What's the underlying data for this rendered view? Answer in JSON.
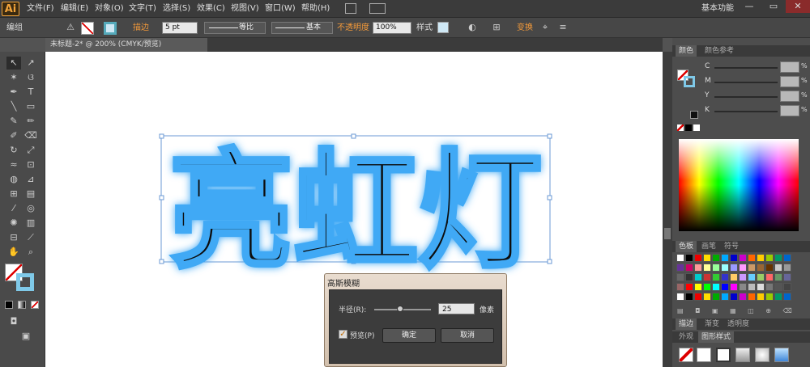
{
  "app": {
    "logo": "Ai",
    "workspace": "基本功能"
  },
  "menubar": {
    "items": [
      "文件(F)",
      "编辑(E)",
      "对象(O)",
      "文字(T)",
      "选择(S)",
      "效果(C)",
      "视图(V)",
      "窗口(W)",
      "帮助(H)"
    ]
  },
  "window_buttons": {
    "minimize": "—",
    "restore": "▭",
    "close": "✕"
  },
  "control_bar": {
    "selection_label": "编组",
    "stroke_label": "描边",
    "stroke_weight": "5 pt",
    "stroke_profile": "等比",
    "brush_label": "基本",
    "opacity_label": "不透明度",
    "opacity_value": "100%",
    "style_label": "样式",
    "transform_label": "变换"
  },
  "document": {
    "tab_title": "未标题-2* @ 200% (CMYK/预览)",
    "artwork_text": "亮虹灯"
  },
  "panels": {
    "color": {
      "tab_active": "颜色",
      "tab_inactive": "颜色参考",
      "channels": [
        "C",
        "M",
        "Y",
        "K"
      ],
      "unit": "%"
    },
    "swatches": {
      "tabs": [
        "色板",
        "画笔",
        "符号"
      ]
    },
    "stroke": {
      "tabs": [
        "描边",
        "渐变",
        "透明度"
      ]
    },
    "appearance": {
      "tabs": [
        "外观",
        "图形样式"
      ]
    }
  },
  "dialog": {
    "title": "高斯模糊",
    "radius_label": "半径(R):",
    "radius_value": "25",
    "radius_unit": "像素",
    "preview_label": "预览(P)",
    "preview_checked": true,
    "ok_label": "确定",
    "cancel_label": "取消",
    "radius_slider_fraction": 0.45
  },
  "colors": {
    "accent_orange": "#f2993a",
    "glow_blue": "#3fa9f5",
    "ui_dark": "#474747"
  }
}
